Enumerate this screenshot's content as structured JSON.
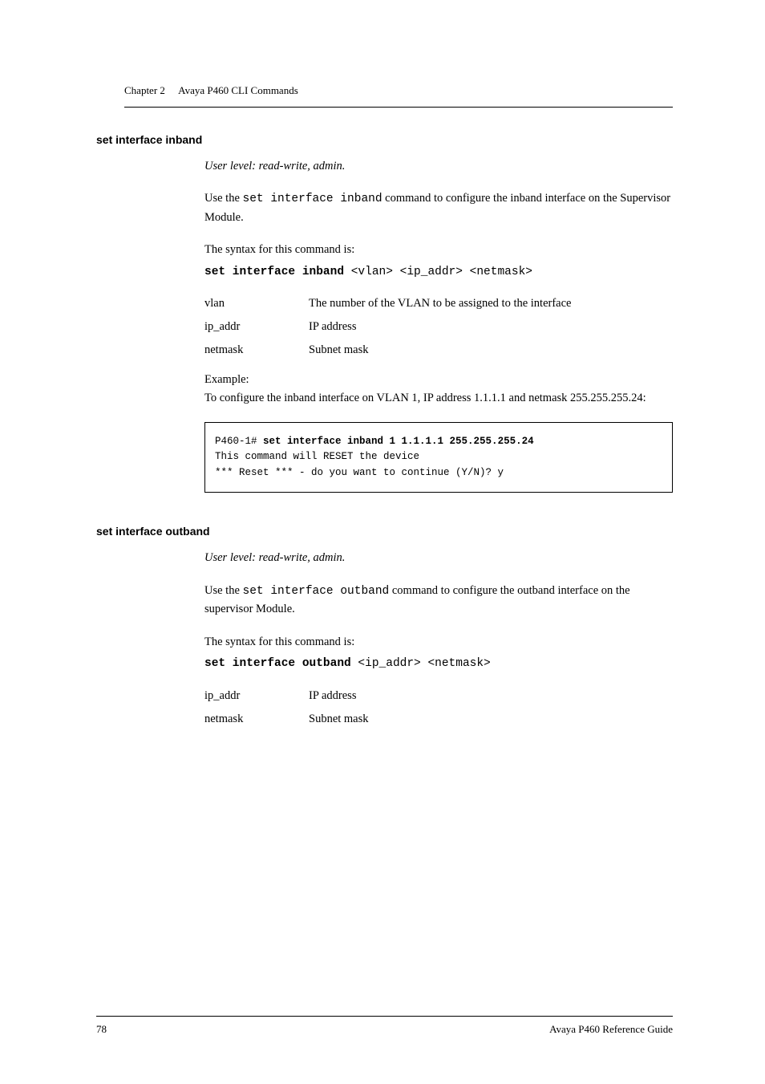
{
  "header": {
    "chapter": "Chapter 2",
    "title": "Avaya P460 CLI Commands"
  },
  "section1": {
    "heading": "set interface inband",
    "user_level": "User level: read-write, admin.",
    "description_prefix": "Use the ",
    "description_cmd": "set interface inband",
    "description_suffix": " command to configure the inband interface on the Supervisor Module.",
    "syntax_intro": "The syntax for this command is:",
    "syntax_bold": "set interface inband",
    "syntax_args": " <vlan> <ip_addr> <netmask>",
    "params": [
      {
        "name": "vlan",
        "desc": "The number of the VLAN to be assigned to the interface"
      },
      {
        "name": "ip_addr",
        "desc": "IP address"
      },
      {
        "name": "netmask",
        "desc": "Subnet mask"
      }
    ],
    "example_label": "Example:",
    "example_text": "To configure the inband interface on VLAN 1, IP address 1.1.1.1 and netmask 255.255.255.24:",
    "code_prompt": "P460-1# ",
    "code_cmd": "set interface inband 1 1.1.1.1 255.255.255.24",
    "code_line2": "This command will RESET the device",
    "code_line3": "*** Reset *** - do you want to continue (Y/N)? y"
  },
  "section2": {
    "heading": "set interface outband",
    "user_level": "User level: read-write, admin.",
    "description_prefix": "Use the ",
    "description_cmd": "set interface outband",
    "description_suffix": " command to configure the outband interface on the supervisor Module.",
    "syntax_intro": "The syntax for this command is:",
    "syntax_bold": "set interface outband",
    "syntax_args": " <ip_addr> <netmask>",
    "params": [
      {
        "name": "ip_addr",
        "desc": "IP address"
      },
      {
        "name": "netmask",
        "desc": "Subnet mask"
      }
    ]
  },
  "footer": {
    "page": "78",
    "text": "Avaya P460 Reference Guide"
  }
}
